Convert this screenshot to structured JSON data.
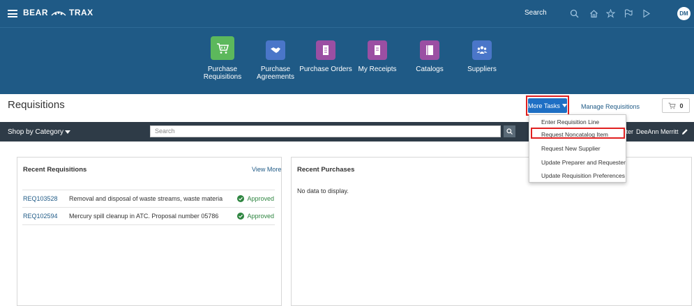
{
  "header": {
    "logo_text_left": "BEAR",
    "logo_text_right": "TRAX",
    "search_label": "Search",
    "avatar_initials": "DM"
  },
  "nav": [
    {
      "label": "Purchase Requisitions",
      "icon": "cart-icon",
      "color": "#5cb85c"
    },
    {
      "label": "Purchase Agreements",
      "icon": "handshake-icon",
      "color": "#4a76c9"
    },
    {
      "label": "Purchase Orders",
      "icon": "document-icon",
      "color": "#9b4fa3"
    },
    {
      "label": "My Receipts",
      "icon": "receipt-icon",
      "color": "#9b4fa3"
    },
    {
      "label": "Catalogs",
      "icon": "book-icon",
      "color": "#9b4fa3"
    },
    {
      "label": "Suppliers",
      "icon": "people-icon",
      "color": "#4a76c9"
    }
  ],
  "page": {
    "title": "Requisitions",
    "more_tasks_label": "More Tasks",
    "manage_requisitions_label": "Manage Requisitions",
    "cart_count": "0"
  },
  "category_bar": {
    "shop_by_category": "Shop by Category",
    "search_placeholder": "Search",
    "requester_label": "ester",
    "requester_name": "DeeAnn Merritt"
  },
  "more_tasks_menu": [
    "Enter Requisition Line",
    "Request Noncatalog Item",
    "Request New Supplier",
    "Update Preparer and Requester",
    "Update Requisition Preferences"
  ],
  "recent_requisitions": {
    "title": "Recent Requisitions",
    "view_more": "View More",
    "rows": [
      {
        "number": "REQ103528",
        "description": "Removal and disposal of waste streams, waste materials",
        "status": "Approved"
      },
      {
        "number": "REQ102594",
        "description": "Mercury spill cleanup in ATC. Proposal number 05786",
        "status": "Approved"
      }
    ]
  },
  "recent_purchases": {
    "title": "Recent Purchases",
    "empty_text": "No data to display."
  },
  "colors": {
    "header_bg": "#1f5a86",
    "category_bar_bg": "#2e3b47",
    "accent_blue": "#1e6fc4",
    "highlight_red": "#e02020",
    "approved_green": "#2e8540"
  }
}
